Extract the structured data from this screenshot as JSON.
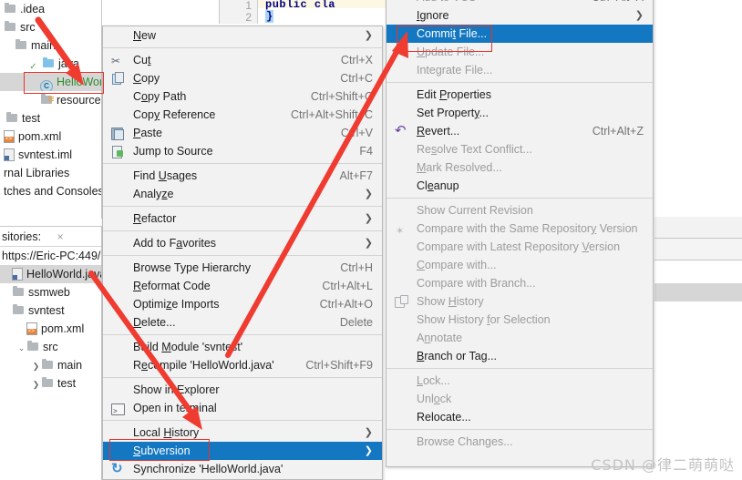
{
  "project_tree": {
    "rows": [
      {
        "label": ".idea",
        "indent": 0,
        "icon": "folder-icon",
        "clip_left": true
      },
      {
        "label": "src",
        "indent": 0,
        "icon": "folder-icon",
        "clip_left": true
      },
      {
        "label": "main",
        "indent": 1,
        "icon": "folder-icon",
        "clip_left": false
      },
      {
        "label": "java",
        "indent": 2,
        "icon": "source-folder-icon",
        "chev": "v",
        "clip_left": false
      },
      {
        "label": "HelloWor",
        "indent": 3,
        "icon": "java-class-icon",
        "selected": true,
        "green": true,
        "clip_left": false
      },
      {
        "label": "resources",
        "indent": 3,
        "icon": "resources-folder-icon",
        "clip_left": false
      },
      {
        "label": "test",
        "indent": 1,
        "icon": "folder-icon",
        "clip_left": true
      },
      {
        "label": "pom.xml",
        "indent": 0,
        "icon": "xml-file-icon",
        "clip_left": true
      },
      {
        "label": "svntest.iml",
        "indent": 0,
        "icon": "file-icon",
        "clip_left": true
      },
      {
        "label": "rnal Libraries",
        "indent": 0,
        "icon": "none",
        "clip_left": true
      },
      {
        "label": "tches and Consoles",
        "indent": 0,
        "icon": "none",
        "clip_left": true
      }
    ]
  },
  "repo_pane": {
    "title": "sitories:",
    "close_icon": "×",
    "url": "https://Eric-PC:449/",
    "rows": [
      {
        "label": "HelloWorld.java",
        "indent": 0,
        "icon": "file-icon",
        "selected": true
      },
      {
        "label": "ssmweb",
        "indent": 0,
        "icon": "folder-icon"
      },
      {
        "label": "svntest",
        "indent": 0,
        "icon": "folder-icon"
      },
      {
        "label": "pom.xml",
        "indent": 1,
        "icon": "xml-file-icon"
      },
      {
        "label": "src",
        "indent": 1,
        "icon": "folder-icon",
        "chev": "v"
      },
      {
        "label": "main",
        "indent": 2,
        "icon": "folder-icon",
        "chev": ">"
      },
      {
        "label": "test",
        "indent": 2,
        "icon": "folder-icon",
        "chev": ">"
      }
    ]
  },
  "editor": {
    "line_numbers": [
      "1",
      "2"
    ],
    "code_line_1": "public cla",
    "code_line_2": "}"
  },
  "context_menu": {
    "items": [
      {
        "label": "New",
        "mnemonic": "N",
        "arrow": true,
        "icon": "none"
      },
      {
        "sep": true
      },
      {
        "label": "Cut",
        "mnemonic": "t",
        "shortcut": "Ctrl+X",
        "icon": "scissors-icon"
      },
      {
        "label": "Copy",
        "mnemonic": "C",
        "shortcut": "Ctrl+C",
        "icon": "copy-icon"
      },
      {
        "label": "Copy Path",
        "mnemonic": "o",
        "shortcut": "Ctrl+Shift+C",
        "icon": "none"
      },
      {
        "label": "Copy Reference",
        "mnemonic": "y",
        "shortcut": "Ctrl+Alt+Shift+C",
        "icon": "none"
      },
      {
        "label": "Paste",
        "mnemonic": "P",
        "shortcut": "Ctrl+V",
        "icon": "paste-icon"
      },
      {
        "label": "Jump to Source",
        "shortcut": "F4",
        "icon": "jump-to-source-icon"
      },
      {
        "sep": true
      },
      {
        "label": "Find Usages",
        "mnemonic": "U",
        "shortcut": "Alt+F7",
        "icon": "none"
      },
      {
        "label": "Analyze",
        "mnemonic": "z",
        "arrow": true,
        "icon": "none"
      },
      {
        "sep": true
      },
      {
        "label": "Refactor",
        "mnemonic": "R",
        "arrow": true,
        "icon": "none"
      },
      {
        "sep": true
      },
      {
        "label": "Add to Favorites",
        "mnemonic": "a",
        "arrow": true,
        "icon": "none"
      },
      {
        "sep": true
      },
      {
        "label": "Browse Type Hierarchy",
        "shortcut": "Ctrl+H",
        "icon": "none"
      },
      {
        "label": "Reformat Code",
        "mnemonic": "R",
        "shortcut": "Ctrl+Alt+L",
        "icon": "none"
      },
      {
        "label": "Optimize Imports",
        "mnemonic": "z",
        "shortcut": "Ctrl+Alt+O",
        "icon": "none"
      },
      {
        "label": "Delete...",
        "mnemonic": "D",
        "shortcut": "Delete",
        "icon": "none"
      },
      {
        "sep": true
      },
      {
        "label": "Build Module 'svntest'",
        "mnemonic": "M",
        "icon": "none"
      },
      {
        "label": "Recompile 'HelloWorld.java'",
        "mnemonic": "e",
        "shortcut": "Ctrl+Shift+F9",
        "icon": "none"
      },
      {
        "sep": true
      },
      {
        "label": "Show in Explorer",
        "icon": "none"
      },
      {
        "label": "Open in terminal",
        "icon": "terminal-icon"
      },
      {
        "sep": true
      },
      {
        "label": "Local History",
        "mnemonic": "H",
        "arrow": true,
        "icon": "none"
      },
      {
        "label": "Subversion",
        "mnemonic": "S",
        "arrow": true,
        "icon": "none",
        "highlighted": true
      },
      {
        "label": "Synchronize 'HelloWorld.java'",
        "icon": "sync-icon"
      }
    ]
  },
  "submenu": {
    "items": [
      {
        "label": "Add to VCS",
        "shortcut": "Ctrl+Alt+A",
        "disabled": true,
        "clipped_top": true,
        "icon": "none"
      },
      {
        "label": "Ignore",
        "mnemonic": "I",
        "arrow": true,
        "icon": "none"
      },
      {
        "label": "Commit File...",
        "mnemonic": "t",
        "highlighted": true,
        "icon": "none"
      },
      {
        "label": "Update File...",
        "mnemonic": "U",
        "disabled": true,
        "icon": "none"
      },
      {
        "label": "Integrate File...",
        "disabled": true,
        "icon": "none"
      },
      {
        "sep": true
      },
      {
        "label": "Edit Properties",
        "mnemonic": "P",
        "icon": "none"
      },
      {
        "label": "Set Property...",
        "mnemonic": "y",
        "icon": "none"
      },
      {
        "label": "Revert...",
        "mnemonic": "R",
        "shortcut": "Ctrl+Alt+Z",
        "icon": "revert-icon"
      },
      {
        "label": "Resolve Text Conflict...",
        "mnemonic": "s",
        "disabled": true,
        "icon": "none"
      },
      {
        "label": "Mark Resolved...",
        "mnemonic": "M",
        "disabled": true,
        "icon": "none"
      },
      {
        "label": "Cleanup",
        "mnemonic": "e",
        "icon": "none"
      },
      {
        "sep": true
      },
      {
        "label": "Show Current Revision",
        "disabled": true,
        "icon": "none"
      },
      {
        "label": "Compare with the Same Repository Version",
        "mnemonic": "y",
        "disabled": true,
        "icon": "compare-icon"
      },
      {
        "label": "Compare with Latest Repository Version",
        "mnemonic": "V",
        "disabled": true,
        "icon": "none"
      },
      {
        "label": "Compare with...",
        "mnemonic": "C",
        "disabled": true,
        "icon": "none"
      },
      {
        "label": "Compare with Branch...",
        "disabled": true,
        "icon": "none"
      },
      {
        "label": "Show History",
        "mnemonic": "H",
        "disabled": true,
        "icon": "history-icon"
      },
      {
        "label": "Show History for Selection",
        "mnemonic": "f",
        "disabled": true,
        "icon": "none"
      },
      {
        "label": "Annotate",
        "mnemonic": "n",
        "disabled": true,
        "icon": "none"
      },
      {
        "label": "Branch or Tag...",
        "mnemonic": "B",
        "icon": "none"
      },
      {
        "sep": true
      },
      {
        "label": "Lock...",
        "mnemonic": "L",
        "disabled": true,
        "icon": "none"
      },
      {
        "label": "Unlock",
        "mnemonic": "o",
        "disabled": true,
        "icon": "none"
      },
      {
        "label": "Relocate...",
        "icon": "none"
      },
      {
        "sep": true
      },
      {
        "label": "Browse Changes...",
        "disabled": true,
        "icon": "none"
      }
    ]
  },
  "annotations": {
    "arrow_color": "#ef3b30",
    "box_color": "#e8332a",
    "highlight_color": "#1477c1",
    "arrow_count": 3
  },
  "watermark": "CSDN @律二萌萌哒"
}
